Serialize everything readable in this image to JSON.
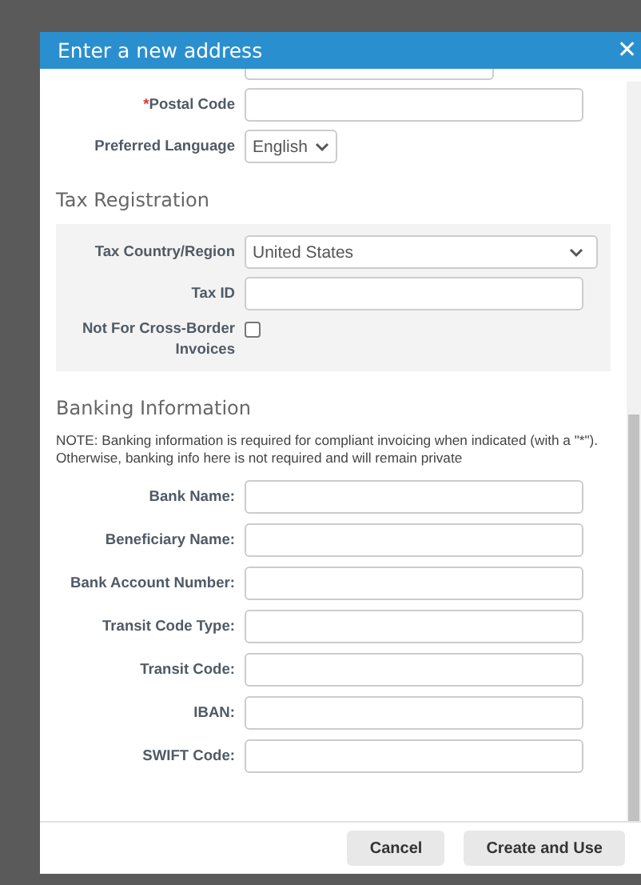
{
  "dialog": {
    "title": "Enter a new address",
    "close": "✕"
  },
  "address_fields": [
    {
      "kind": "text",
      "label": "Postal Code",
      "required_mark": "*"
    },
    {
      "kind": "select",
      "label": "Preferred Language",
      "value": "English"
    }
  ],
  "tax_registration": {
    "heading": "Tax Registration",
    "fields": [
      {
        "kind": "select",
        "label": "Tax Country/Region",
        "value": "United States"
      },
      {
        "kind": "text",
        "label": "Tax ID"
      },
      {
        "kind": "checkbox",
        "label": "Not For Cross-Border Invoices",
        "checked": false
      }
    ]
  },
  "banking": {
    "heading": "Banking Information",
    "note": "NOTE: Banking information is required for compliant invoicing when indicated (with a \"*\"). Otherwise, banking info here is not required and will remain private",
    "fields": [
      {
        "label": "Bank Name:"
      },
      {
        "label": "Beneficiary Name:"
      },
      {
        "label": "Bank Account Number:"
      },
      {
        "label": "Transit Code Type:"
      },
      {
        "label": "Transit Code:"
      },
      {
        "label": "IBAN:"
      },
      {
        "label": "SWIFT Code:"
      }
    ]
  },
  "buttons": [
    {
      "label": "Cancel"
    },
    {
      "label": "Create and Use"
    }
  ]
}
